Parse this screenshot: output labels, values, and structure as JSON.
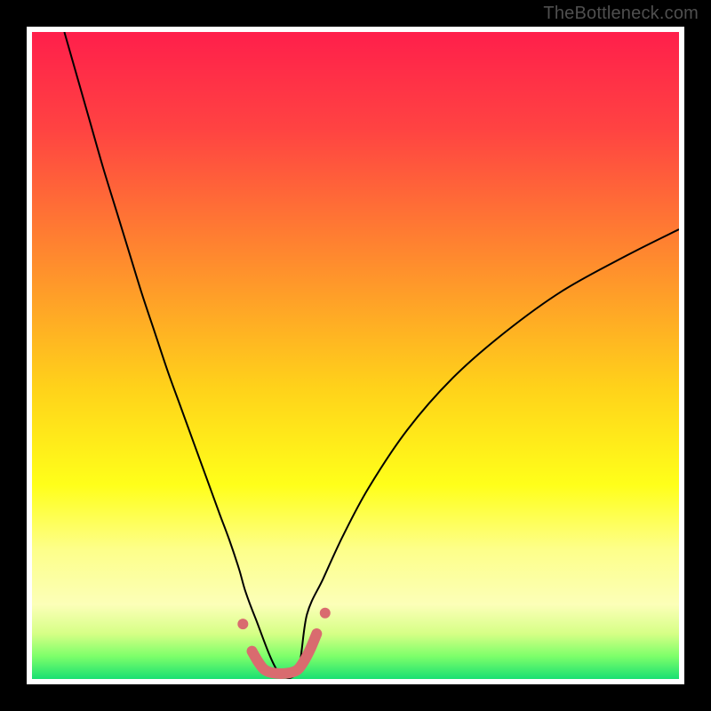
{
  "watermark": {
    "text": "TheBottleneck.com"
  },
  "chart_data": {
    "type": "line",
    "title": "",
    "xlabel": "",
    "ylabel": "",
    "xlim": [
      0,
      100
    ],
    "ylim": [
      0,
      100
    ],
    "grid": false,
    "legend": false,
    "background_gradient_stops": [
      {
        "offset": 0.0,
        "color": "#ff1f4b"
      },
      {
        "offset": 0.15,
        "color": "#ff4342"
      },
      {
        "offset": 0.35,
        "color": "#ff8a2e"
      },
      {
        "offset": 0.55,
        "color": "#ffd21a"
      },
      {
        "offset": 0.7,
        "color": "#ffff1a"
      },
      {
        "offset": 0.8,
        "color": "#fdff8a"
      },
      {
        "offset": 0.885,
        "color": "#fcffb8"
      },
      {
        "offset": 0.93,
        "color": "#d6ff86"
      },
      {
        "offset": 0.965,
        "color": "#7dff6a"
      },
      {
        "offset": 1.0,
        "color": "#19e072"
      }
    ],
    "series": [
      {
        "name": "bottleneck-curve",
        "color": "#000000",
        "stroke_width": 2,
        "x": [
          5,
          7,
          9,
          11,
          13,
          15,
          17,
          19,
          21,
          23,
          25,
          27,
          29,
          30.5,
          32,
          33,
          34.5,
          38,
          41,
          42.5,
          45,
          48,
          52,
          58,
          65,
          73,
          82,
          92,
          100
        ],
        "y": [
          100,
          93,
          86,
          79,
          72.5,
          66,
          59.5,
          53.5,
          47.5,
          42,
          36.5,
          31,
          25.5,
          21.5,
          17,
          13.5,
          9.5,
          1.2,
          1.2,
          10,
          15.5,
          22,
          29.5,
          38.5,
          46.5,
          53.5,
          60,
          65.5,
          69.5
        ]
      },
      {
        "name": "highlight-band",
        "color": "#d96b6f",
        "stroke_width": 12,
        "linecap": "round",
        "x": [
          34,
          35,
          36,
          37.5,
          39.5,
          41,
          42,
          43,
          44
        ],
        "y": [
          4.3,
          2.6,
          1.4,
          0.9,
          0.9,
          1.4,
          2.7,
          4.6,
          7.0
        ]
      }
    ],
    "markers": [
      {
        "name": "left-outer-dot",
        "x": 32.6,
        "y": 8.5,
        "r": 6,
        "color": "#d96b6f"
      },
      {
        "name": "right-outer-dot",
        "x": 45.3,
        "y": 10.2,
        "r": 6,
        "color": "#d96b6f"
      }
    ]
  }
}
